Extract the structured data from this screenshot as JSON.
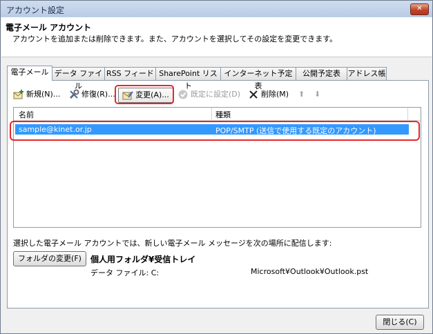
{
  "window": {
    "title": "アカウント設定",
    "close_glyph": "✕"
  },
  "header": {
    "title": "電子メール アカウント",
    "description": "アカウントを追加または削除できます。また、アカウントを選択してその設定を変更できます。"
  },
  "tabs": [
    {
      "label": "電子メール",
      "active": true
    },
    {
      "label": "データ ファイル"
    },
    {
      "label": "RSS フィード"
    },
    {
      "label": "SharePoint リスト"
    },
    {
      "label": "インターネット予定表"
    },
    {
      "label": "公開予定表"
    },
    {
      "label": "アドレス帳"
    }
  ],
  "toolbar": {
    "new_label": "新規(N)...",
    "repair_label": "修復(R)...",
    "change_label": "変更(A)...",
    "default_label": "既定に設定(D)",
    "delete_label": "削除(M)",
    "up_glyph": "⬆",
    "down_glyph": "⬇"
  },
  "list": {
    "columns": [
      "名前",
      "種類"
    ],
    "rows": [
      {
        "name": "sample@kinet.or.jp",
        "type": "POP/SMTP (送信で使用する既定のアカウント)",
        "selected": true
      }
    ]
  },
  "delivery": {
    "text": "選択した電子メール アカウントでは、新しい電子メール メッセージを次の場所に配信します:",
    "change_folder_label": "フォルダの変更(F)",
    "folder_name": "個人用フォルダ¥受信トレイ",
    "data_file_label": "データ ファイル: C:",
    "data_file_path": "Microsoft¥Outlook¥Outlook.pst"
  },
  "footer": {
    "close_label": "閉じる(C)"
  },
  "colors": {
    "selection": "#3399ff",
    "highlight": "#e3272a",
    "titlebar": "#c4d4ea"
  }
}
